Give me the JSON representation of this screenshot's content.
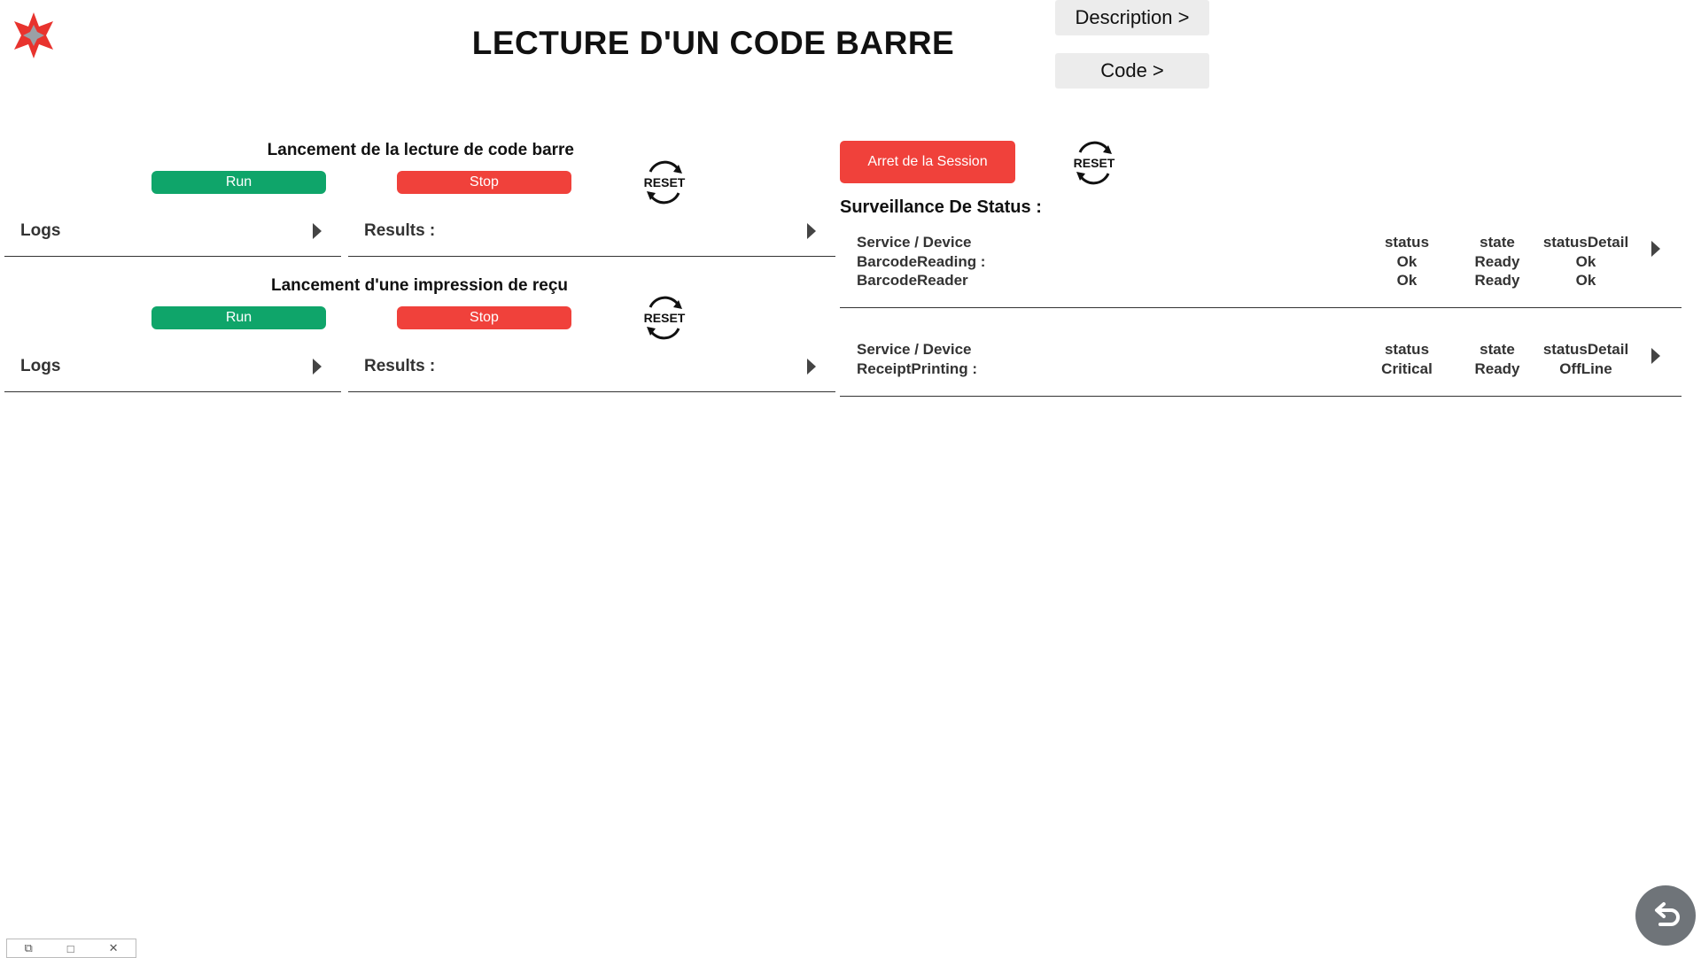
{
  "header": {
    "title": "LECTURE D'UN CODE BARRE",
    "description_btn": "Description >",
    "code_btn": "Code >"
  },
  "barcode_section": {
    "title": "Lancement de la lecture de code barre",
    "run": "Run",
    "stop": "Stop",
    "logs": "Logs",
    "results": "Results :"
  },
  "receipt_section": {
    "title": "Lancement d'une impression de reçu",
    "run": "Run",
    "stop": "Stop",
    "logs": "Logs",
    "results": "Results :"
  },
  "reset_label": "RESET",
  "session": {
    "stop_button": "Arret de la Session",
    "status_heading": "Surveillance De Status :"
  },
  "status_table_1": {
    "header": {
      "name": "Service / Device",
      "status": "status",
      "state": "state",
      "detail": "statusDetail"
    },
    "rows": [
      {
        "name": "BarcodeReading :",
        "status": "Ok",
        "state": "Ready",
        "detail": "Ok"
      },
      {
        "name": "BarcodeReader",
        "status": "Ok",
        "state": "Ready",
        "detail": "Ok"
      }
    ]
  },
  "status_table_2": {
    "header": {
      "name": "Service / Device",
      "status": "status",
      "state": "state",
      "detail": "statusDetail"
    },
    "rows": [
      {
        "name": "ReceiptPrinting :",
        "status": "Critical",
        "state": "Ready",
        "detail": "OffLine"
      }
    ]
  },
  "colors": {
    "run": "#0fa56a",
    "stop": "#f0413b",
    "logo": "#e8332e",
    "back_button": "#6f7479"
  },
  "icons": {
    "logo": "star-compass-logo",
    "reset": "refresh-arrows-icon",
    "back": "return-arrow-icon",
    "expand": "triangle-right-icon"
  }
}
